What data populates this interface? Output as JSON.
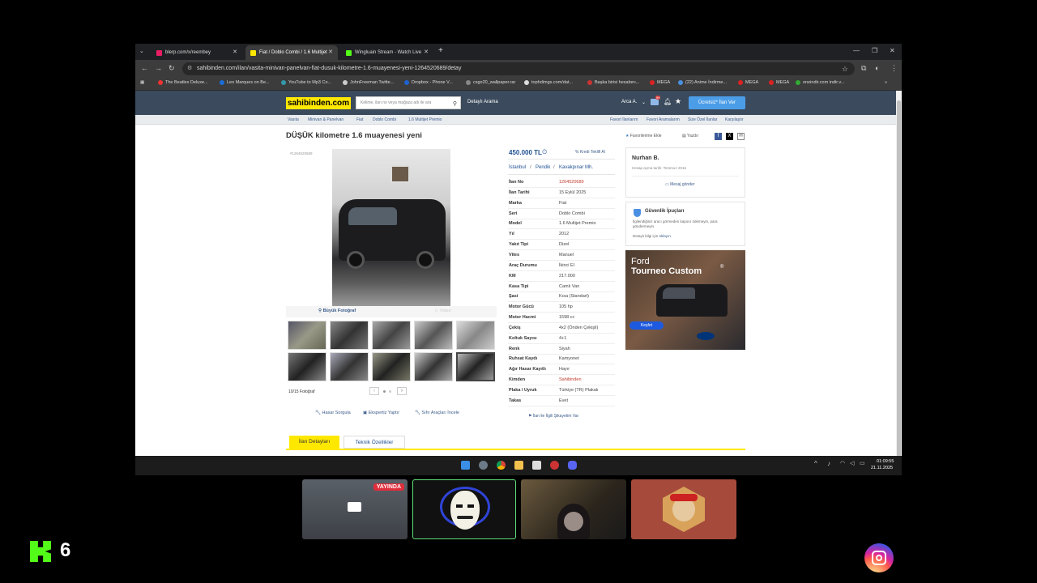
{
  "browser": {
    "tabs": [
      {
        "title": "blerp.com/x/reembey",
        "favicon_color": "#e91e63"
      },
      {
        "title": "Fiat / Doblo Combi / 1.6 Multijet",
        "favicon_color": "#ffe800"
      },
      {
        "title": "Wingluain Stream - Watch Live",
        "favicon_color": "#53fc18"
      }
    ],
    "new_tab": "+",
    "url": "sahibinden.com/ilan/vasita-minivan-panelvan-fiat-dusuk-kilometre-1.6-muayenesi-yeni-1264520689/detay",
    "bookmarks": [
      "The Beatles Deluxe...",
      "Leo Marques on Be...",
      "YouTube to Mp3 Co...",
      "JohnFreeman Twitte...",
      "Dropbox - Phone V...",
      "csgo20_wallpaper.rar",
      "tophdimgs.com/dat...",
      "Başka birisi hesabını...",
      "MEGA",
      "(22) Anime İndirme...",
      "MEGA",
      "MEGA",
      "oneindir.com indir.v..."
    ]
  },
  "site": {
    "logo": "sahibinden.com",
    "search_placeholder": "Kelime, ilan no veya mağaza adı ile ara",
    "detailed_search": "Detaylı Arama",
    "user": "Arca A.",
    "notif_count": "99",
    "post_button": "Ücretsiz* İlan Ver",
    "breadcrumbs": [
      "Vasıta",
      "Minivan & Panelvan",
      "Fiat",
      "Doblo Combi",
      "1.6 Multijet Premio"
    ],
    "right_links": [
      "Favori İlanlarım",
      "Favori Aramalarım",
      "Size Özel İlanlar",
      "Karşılaştır"
    ]
  },
  "listing": {
    "title": "DÜŞÜK kilometre 1.6 muayenesi yeni",
    "add_fav": "Favorilerime Ekle",
    "print": "Yazdır",
    "id_small": "#1264520689",
    "big_photo": "Büyük Fotoğraf",
    "video": "Video",
    "photo_count": "10/15 Fotoğraf",
    "price": "450.000 TL",
    "credit": "Kredi Teklifi Al",
    "location": [
      "İstanbul",
      "Pendik",
      "Kavakpınar Mh."
    ],
    "details": [
      {
        "k": "İlan No",
        "v": "1264520689",
        "red": true
      },
      {
        "k": "İlan Tarihi",
        "v": "15 Eylül 2025"
      },
      {
        "k": "Marka",
        "v": "Fiat"
      },
      {
        "k": "Seri",
        "v": "Doblo Combi"
      },
      {
        "k": "Model",
        "v": "1.6 Multijet Premio"
      },
      {
        "k": "Yıl",
        "v": "2012"
      },
      {
        "k": "Yakıt Tipi",
        "v": "Dizel"
      },
      {
        "k": "Vites",
        "v": "Manuel"
      },
      {
        "k": "Araç Durumu",
        "v": "İkinci El"
      },
      {
        "k": "KM",
        "v": "217.000"
      },
      {
        "k": "Kasa Tipi",
        "v": "Camlı Van"
      },
      {
        "k": "Şasi",
        "v": "Kısa (Standart)"
      },
      {
        "k": "Motor Gücü",
        "v": "105 hp"
      },
      {
        "k": "Motor Hacmi",
        "v": "1598 cc"
      },
      {
        "k": "Çekiş",
        "v": "4x2 (Önden Çekişli)"
      },
      {
        "k": "Koltuk Sayısı",
        "v": "4+1"
      },
      {
        "k": "Renk",
        "v": "Siyah"
      },
      {
        "k": "Ruhsat Kaydı",
        "v": "Kamyonet"
      },
      {
        "k": "Ağır Hasar Kayıtlı",
        "v": "Hayır"
      },
      {
        "k": "Kimden",
        "v": "Sahibinden",
        "red": true
      },
      {
        "k": "Plaka / Uyruk",
        "v": "Türkiye (TR) Plakalı"
      },
      {
        "k": "Takas",
        "v": "Evet"
      }
    ],
    "bottom_links": [
      "Hasar Sorgula",
      "Ekspertiz Yaptır",
      "Sıfır Araçları İncele"
    ],
    "complaint": "İlan ile İlgili Şikayetim Var",
    "tabs": [
      "İlan Detayları",
      "Teknik Özellikler"
    ]
  },
  "seller": {
    "name": "Nurhan B.",
    "since": "Hesap açma tarihi: Temmuz 2016",
    "message": "Mesaj gönder"
  },
  "safety": {
    "title": "Güvenlik İpuçları",
    "text": "İlgilendiğiniz aracı görmeden kaporo ödemeyin, para göndermeyin.",
    "more": "Detaylı bilgi için",
    "link": "tıklayın."
  },
  "ad": {
    "brand": "Ford",
    "model": "Tourneo Custom",
    "cta": "Keşfet"
  },
  "taskbar": {
    "time": "01:09:55",
    "date": "21.11.2025"
  },
  "overlay": {
    "live_badge": "YAYINDA",
    "kick_number": "6"
  }
}
